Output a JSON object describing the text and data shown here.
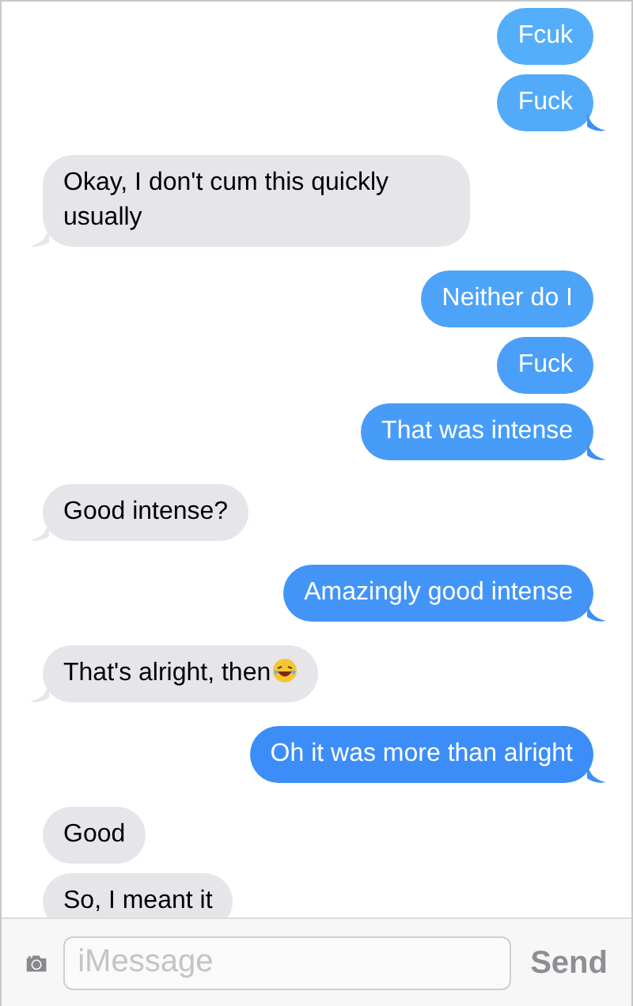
{
  "messages": [
    {
      "kind": "sent",
      "text": "Fcuk",
      "tail": false
    },
    {
      "kind": "sent",
      "text": "Fuck",
      "tail": true
    },
    {
      "kind": "received",
      "text": "Okay, I don't cum this quickly usually",
      "tail": true
    },
    {
      "kind": "sent",
      "text": "Neither do I",
      "tail": false
    },
    {
      "kind": "sent",
      "text": "Fuck",
      "tail": false
    },
    {
      "kind": "sent",
      "text": "That was intense",
      "tail": true
    },
    {
      "kind": "received",
      "text": "Good intense?",
      "tail": true
    },
    {
      "kind": "sent",
      "text": "Amazingly good intense",
      "tail": true
    },
    {
      "kind": "received",
      "text": "That's alright, then",
      "emoji": true,
      "tail": true
    },
    {
      "kind": "sent",
      "text": "Oh it was more than alright",
      "tail": true
    },
    {
      "kind": "received",
      "text": "Good",
      "tail": false
    },
    {
      "kind": "received",
      "text": "So, I meant it"
    }
  ],
  "composer": {
    "placeholder": "iMessage",
    "send": "Send"
  }
}
